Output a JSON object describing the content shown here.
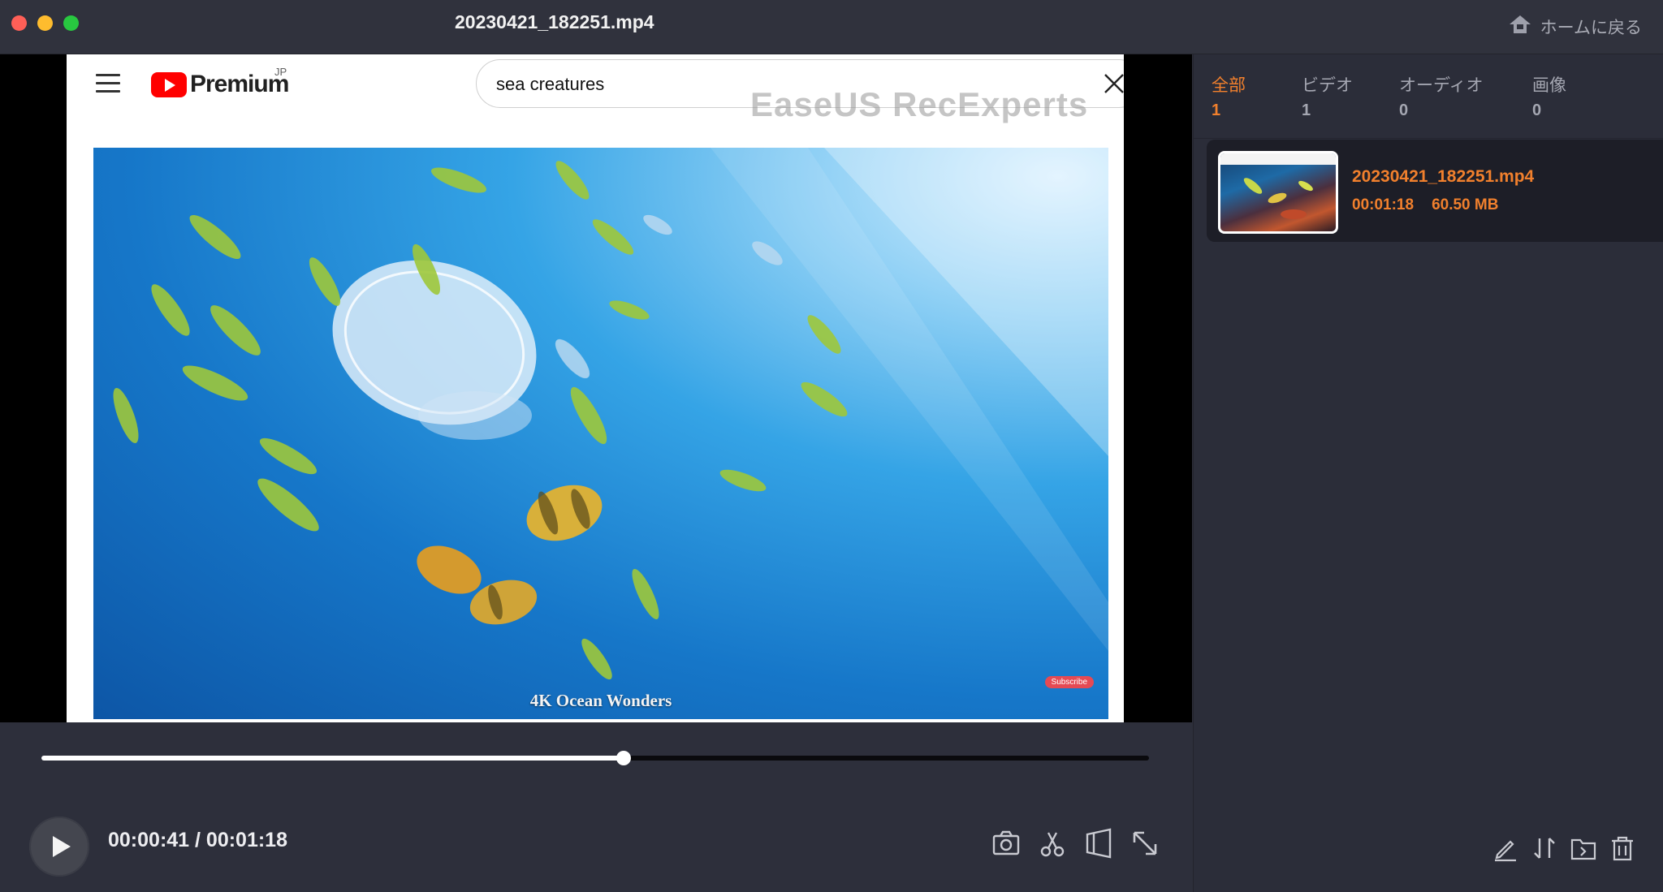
{
  "window": {
    "title": "20230421_182251.mp4",
    "home_label": "ホームに戻る"
  },
  "browser_frame": {
    "brand": "Premium",
    "region": "JP",
    "search_value": "sea creatures",
    "watermark": "EaseUS RecExperts",
    "video_title": "4K Ocean Wonders",
    "subscribe_label": "Subscribe"
  },
  "player": {
    "current_time": "00:00:41",
    "duration": "00:01:18",
    "time_display": "00:00:41 / 00:01:18",
    "progress_fraction": 0.526
  },
  "sidebar": {
    "tabs": [
      {
        "label": "全部",
        "count": "1",
        "active": true
      },
      {
        "label": "ビデオ",
        "count": "1",
        "active": false
      },
      {
        "label": "オーディオ",
        "count": "0",
        "active": false
      },
      {
        "label": "画像",
        "count": "0",
        "active": false
      }
    ],
    "files": [
      {
        "name": "20230421_182251.mp4",
        "duration": "00:01:18",
        "size": "60.50 MB"
      }
    ]
  },
  "icons": {
    "home": "home-icon",
    "screenshot": "camera-icon",
    "trim": "scissors-icon",
    "aspect": "crop-icon",
    "fullscreen": "expand-icon",
    "edit": "pen-icon",
    "sort": "sort-icon",
    "folder": "folder-icon",
    "delete": "trash-icon"
  },
  "colors": {
    "accent": "#f1802d",
    "background": "#2d2f3b",
    "panel": "#1d1e27"
  }
}
